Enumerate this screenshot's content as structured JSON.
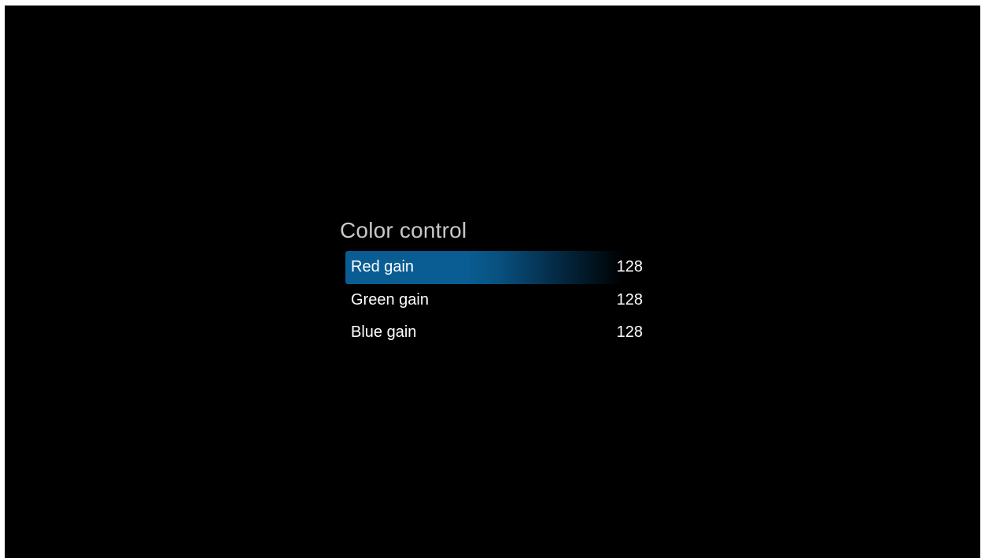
{
  "menu": {
    "title": "Color control",
    "items": [
      {
        "label": "Red gain",
        "value": "128",
        "selected": true
      },
      {
        "label": "Green gain",
        "value": "128",
        "selected": false
      },
      {
        "label": "Blue gain",
        "value": "128",
        "selected": false
      }
    ]
  },
  "colors": {
    "background": "#000000",
    "highlight": "#0a5d93",
    "title_text": "#c8c8c8",
    "item_text": "#ffffff"
  }
}
